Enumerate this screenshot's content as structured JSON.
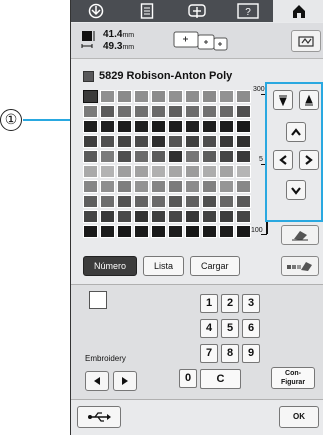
{
  "callout": {
    "number": "①",
    "line_color": "#29a8e0"
  },
  "top_tabs": [
    {
      "icon": "sewing-foot-icon",
      "active": false
    },
    {
      "icon": "document-icon",
      "active": false
    },
    {
      "icon": "embroidery-frame-icon",
      "active": false
    },
    {
      "icon": "help-icon",
      "active": false
    },
    {
      "icon": "home-icon",
      "active": true
    }
  ],
  "info": {
    "width_value": "41.4",
    "width_unit": "mm",
    "height_value": "49.3",
    "height_unit": "mm"
  },
  "color": {
    "code": "5829",
    "name": "Robison-Anton Poly"
  },
  "palette": {
    "rows": [
      [
        "#3a3a3a",
        "#909090",
        "#8a8a8a",
        "#8f8f8f",
        "#8c8c8c",
        "#919191",
        "#8e8e8e",
        "#8b8b8b",
        "#929292",
        "#8d8d8d"
      ],
      [
        "#7a7a7a",
        "#5b5b5b",
        "#6f6f6f",
        "#707070",
        "#6a6a6a",
        "#5f5f5f",
        "#6c6c6c",
        "#707070",
        "#686868",
        "#4f4f4f"
      ],
      [
        "#1e1e1e",
        "#202020",
        "#1c1c1c",
        "#1f1f1f",
        "#1b1b1b",
        "#1d1d1d",
        "#202020",
        "#1e1e1e",
        "#1c1c1c",
        "#1a1a1a"
      ],
      [
        "#3e3e3e",
        "#505050",
        "#444444",
        "#4a4a4a",
        "#2e2e2e",
        "#555555",
        "#404040",
        "#4d4d4d",
        "#383838",
        "#303030"
      ],
      [
        "#5a5a5a",
        "#7c7c7c",
        "#4e4e4e",
        "#6b6b6b",
        "#5c5c5c",
        "#2f2f2f",
        "#777777",
        "#5d5d5d",
        "#454545",
        "#3a3a3a"
      ],
      [
        "#a9a9a9",
        "#b3b3b3",
        "#9e9e9e",
        "#a1a1a1",
        "#b0b0b0",
        "#a6a6a6",
        "#9c9c9c",
        "#adadad",
        "#a3a3a3",
        "#b5b5b5"
      ],
      [
        "#868686",
        "#8f8f8f",
        "#7e7e7e",
        "#939393",
        "#858585",
        "#7b7b7b",
        "#8c8c8c",
        "#818181",
        "#969696",
        "#888888"
      ],
      [
        "#5e5e5e",
        "#6d6d6d",
        "#525252",
        "#636363",
        "#6a6a6a",
        "#575757",
        "#606060",
        "#4f4f4f",
        "#666666",
        "#595959"
      ],
      [
        "#444444",
        "#3b3b3b",
        "#4a4a4a",
        "#333333",
        "#404040",
        "#474747",
        "#373737",
        "#424242",
        "#3d3d3d",
        "#464646"
      ],
      [
        "#1a1a1a",
        "#1c1c1c",
        "#181818",
        "#1b1b1b",
        "#191919",
        "#1d1d1d",
        "#171717",
        "#1a1a1a",
        "#1c1c1c",
        "#181818"
      ]
    ]
  },
  "scale": {
    "top_label": "300",
    "mid_label": "5",
    "bottom_label": "100"
  },
  "navigation": {
    "highlight_color": "#29a8e0",
    "buttons": [
      "jump-down-icon",
      "jump-up-icon",
      "arrow-up-icon",
      "arrow-left-icon",
      "arrow-right-icon",
      "arrow-down-icon"
    ]
  },
  "modes": {
    "number": "Número",
    "list": "Lista",
    "load": "Cargar"
  },
  "lower": {
    "embroidery_label": "Embroidery",
    "keys": [
      "1",
      "2",
      "3",
      "4",
      "5",
      "6",
      "7",
      "8",
      "9",
      "0"
    ],
    "clear_key": "C",
    "configure_line1": "Con-",
    "configure_line2": "Figurar"
  },
  "bottom": {
    "ok_label": "OK"
  }
}
